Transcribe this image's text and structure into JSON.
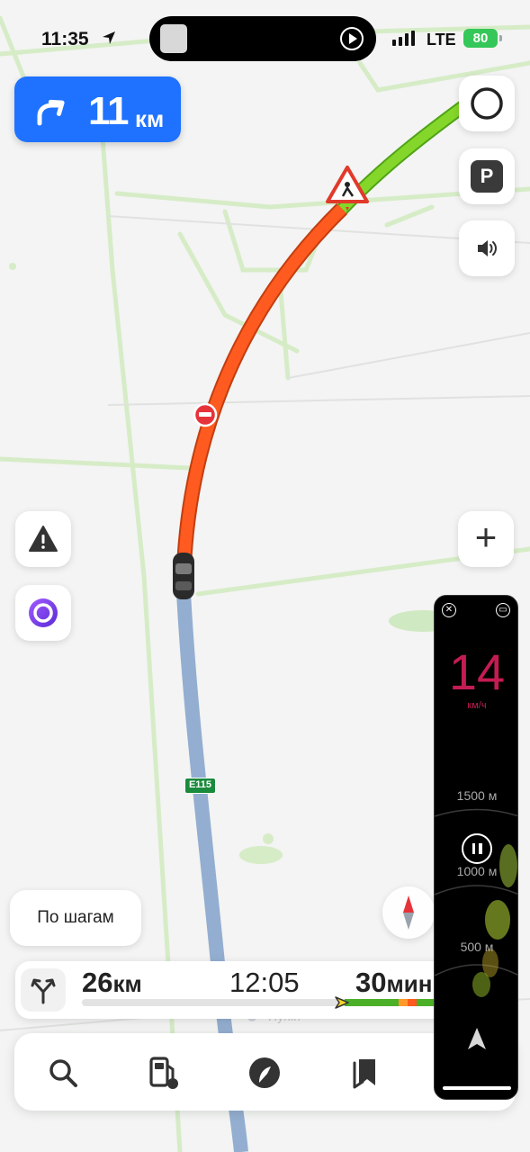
{
  "status_bar": {
    "time": "11:35",
    "network": "LTE",
    "battery": "80"
  },
  "maneuver": {
    "distance": "11",
    "unit": "км",
    "icon": "turn-right-arrow-icon"
  },
  "map": {
    "road_sign": "E115",
    "route_colors": {
      "traffic_heavy": "#ff5a1f",
      "traffic_free": "#7ed321",
      "passed": "#93aed0"
    }
  },
  "buttons": {
    "alice": "alice-assistant-icon",
    "parking": "P",
    "sound": "speaker-icon",
    "alert": "warning-icon",
    "alice_left": "alice-voice-icon",
    "zoom_in": "+"
  },
  "steps_button": {
    "label": "По шагам"
  },
  "route": {
    "distance": "26",
    "distance_unit": "км",
    "arrival_time": "12:05",
    "duration": "30",
    "duration_unit": "мин"
  },
  "pip": {
    "speed": "14",
    "speed_unit": "км/ч",
    "marks": [
      "1500 м",
      "1000 м",
      "500 м"
    ]
  },
  "bottom_nav": [
    "search-icon",
    "fuel-icon",
    "navigator-icon",
    "bookmarks-icon"
  ]
}
